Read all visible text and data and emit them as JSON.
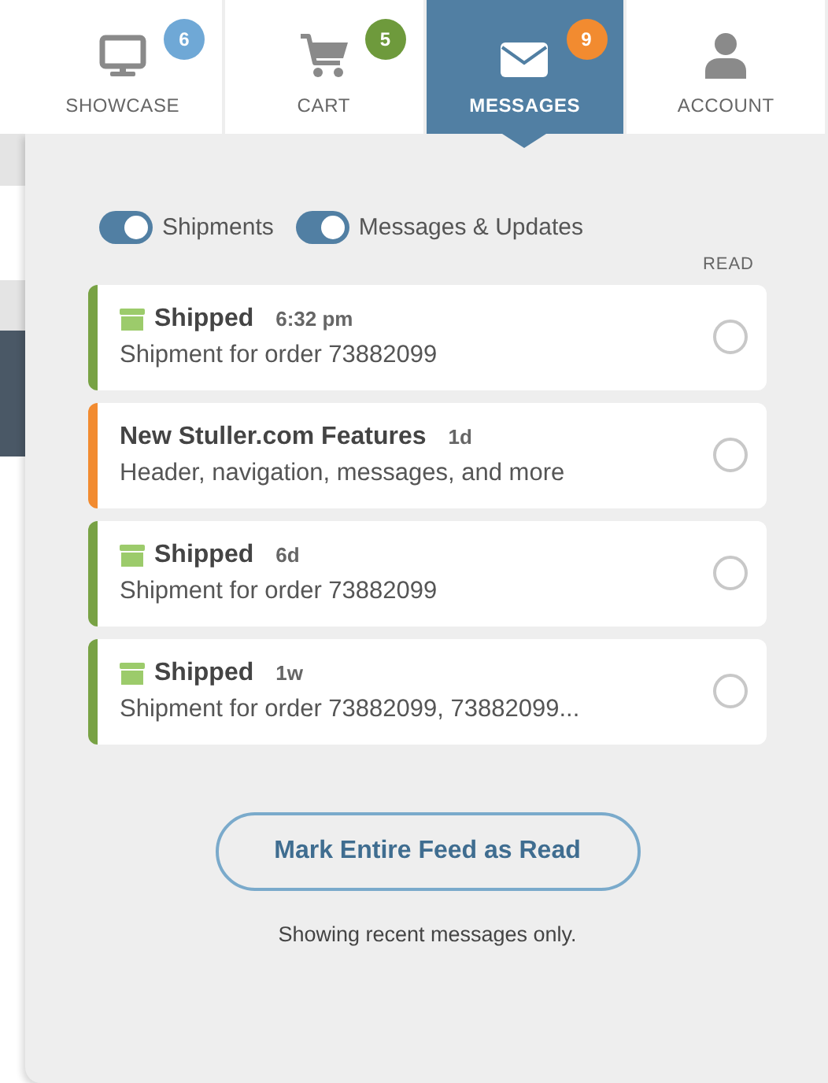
{
  "nav_tabs": [
    {
      "label": "SHOWCASE",
      "badge": "6",
      "color": "#6fa8d6",
      "selected": false
    },
    {
      "label": "CART",
      "badge": "5",
      "color": "#6e9a3c",
      "selected": false
    },
    {
      "label": "MESSAGES",
      "badge": "9",
      "color": "#f28b30",
      "selected": true
    },
    {
      "label": "ACCOUNT",
      "selected": false
    }
  ],
  "filters": [
    {
      "label": "Shipments",
      "on": true
    },
    {
      "label": "Messages & Updates",
      "on": true
    }
  ],
  "read_column": "READ",
  "messages": [
    {
      "kind": "shipment",
      "color": "#78a244",
      "title": "Shipped",
      "time": "6:32 pm",
      "body": "Shipment for order 73882099",
      "read": false
    },
    {
      "kind": "update",
      "color": "#f28b30",
      "title": "New Stuller.com Features",
      "time": "1d",
      "body": "Header, navigation, messages, and more",
      "read": false
    },
    {
      "kind": "shipment",
      "color": "#78a244",
      "title": "Shipped",
      "time": "6d",
      "body": "Shipment for order 73882099",
      "read": false
    },
    {
      "kind": "shipment",
      "color": "#78a244",
      "title": "Shipped",
      "time": "1w",
      "body": "Shipment for order 73882099, 73882099...",
      "read": false
    }
  ],
  "mark_all_button": "Mark Entire Feed as Read",
  "footer_note": "Showing recent messages only."
}
